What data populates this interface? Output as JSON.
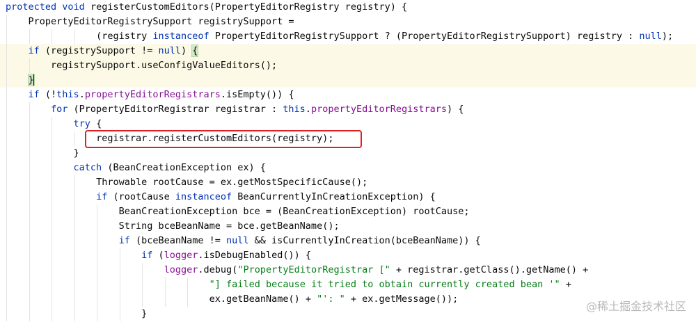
{
  "editor": {
    "lines": [
      [
        [
          "kw",
          "protected"
        ],
        [
          "t",
          " "
        ],
        [
          "kw",
          "void"
        ],
        [
          "t",
          " registerCustomEditors(PropertyEditorRegistry registry) {"
        ]
      ],
      [
        [
          "t",
          "PropertyEditorRegistrySupport registrySupport ="
        ]
      ],
      [
        [
          "t",
          "(registry "
        ],
        [
          "kw",
          "instanceof"
        ],
        [
          "t",
          " PropertyEditorRegistrySupport ? (PropertyEditorRegistrySupport) registry : "
        ],
        [
          "kw",
          "null"
        ],
        [
          "t",
          ");"
        ]
      ],
      [
        [
          "kw",
          "if"
        ],
        [
          "t",
          " (registrySupport != "
        ],
        [
          "kw",
          "null"
        ],
        [
          "t",
          ") "
        ],
        [
          "br",
          "{"
        ]
      ],
      [
        [
          "t",
          "registrySupport.useConfigValueEditors();"
        ]
      ],
      [
        [
          "br",
          "}"
        ],
        [
          "caret",
          ""
        ]
      ],
      [
        [
          "kw",
          "if"
        ],
        [
          "t",
          " (!"
        ],
        [
          "kw",
          "this"
        ],
        [
          "t",
          "."
        ],
        [
          "fld",
          "propertyEditorRegistrars"
        ],
        [
          "t",
          ".isEmpty()) {"
        ]
      ],
      [
        [
          "kw",
          "for"
        ],
        [
          "t",
          " (PropertyEditorRegistrar registrar : "
        ],
        [
          "kw",
          "this"
        ],
        [
          "t",
          "."
        ],
        [
          "fld",
          "propertyEditorRegistrars"
        ],
        [
          "t",
          ") {"
        ]
      ],
      [
        [
          "kw",
          "try"
        ],
        [
          "t",
          " {"
        ]
      ],
      [
        [
          "t",
          "registrar.registerCustomEditors(registry);"
        ]
      ],
      [
        [
          "t",
          "}"
        ]
      ],
      [
        [
          "kw",
          "catch"
        ],
        [
          "t",
          " (BeanCreationException ex) {"
        ]
      ],
      [
        [
          "t",
          "Throwable rootCause = ex.getMostSpecificCause();"
        ]
      ],
      [
        [
          "kw",
          "if"
        ],
        [
          "t",
          " (rootCause "
        ],
        [
          "kw",
          "instanceof"
        ],
        [
          "t",
          " BeanCurrentlyInCreationException) {"
        ]
      ],
      [
        [
          "t",
          "BeanCreationException bce = (BeanCreationException) rootCause;"
        ]
      ],
      [
        [
          "t",
          "String bceBeanName = bce.getBeanName();"
        ]
      ],
      [
        [
          "kw",
          "if"
        ],
        [
          "t",
          " (bceBeanName != "
        ],
        [
          "kw",
          "null"
        ],
        [
          "t",
          " && isCurrentlyInCreation(bceBeanName)) {"
        ]
      ],
      [
        [
          "kw",
          "if"
        ],
        [
          "t",
          " ("
        ],
        [
          "fld",
          "logger"
        ],
        [
          "t",
          ".isDebugEnabled()) {"
        ]
      ],
      [
        [
          "fld",
          "logger"
        ],
        [
          "t",
          ".debug("
        ],
        [
          "str",
          "\"PropertyEditorRegistrar [\""
        ],
        [
          "t",
          " + registrar.getClass().getName() +"
        ]
      ],
      [
        [
          "str",
          "\"] failed because it tried to obtain currently created bean '\""
        ],
        [
          "t",
          " +"
        ]
      ],
      [
        [
          "t",
          "ex.getBeanName() + "
        ],
        [
          "str",
          "\"': \""
        ],
        [
          "t",
          " + ex.getMessage());"
        ]
      ],
      [
        [
          "t",
          "}"
        ]
      ]
    ]
  },
  "watermark": "@稀土掘金技术社区"
}
